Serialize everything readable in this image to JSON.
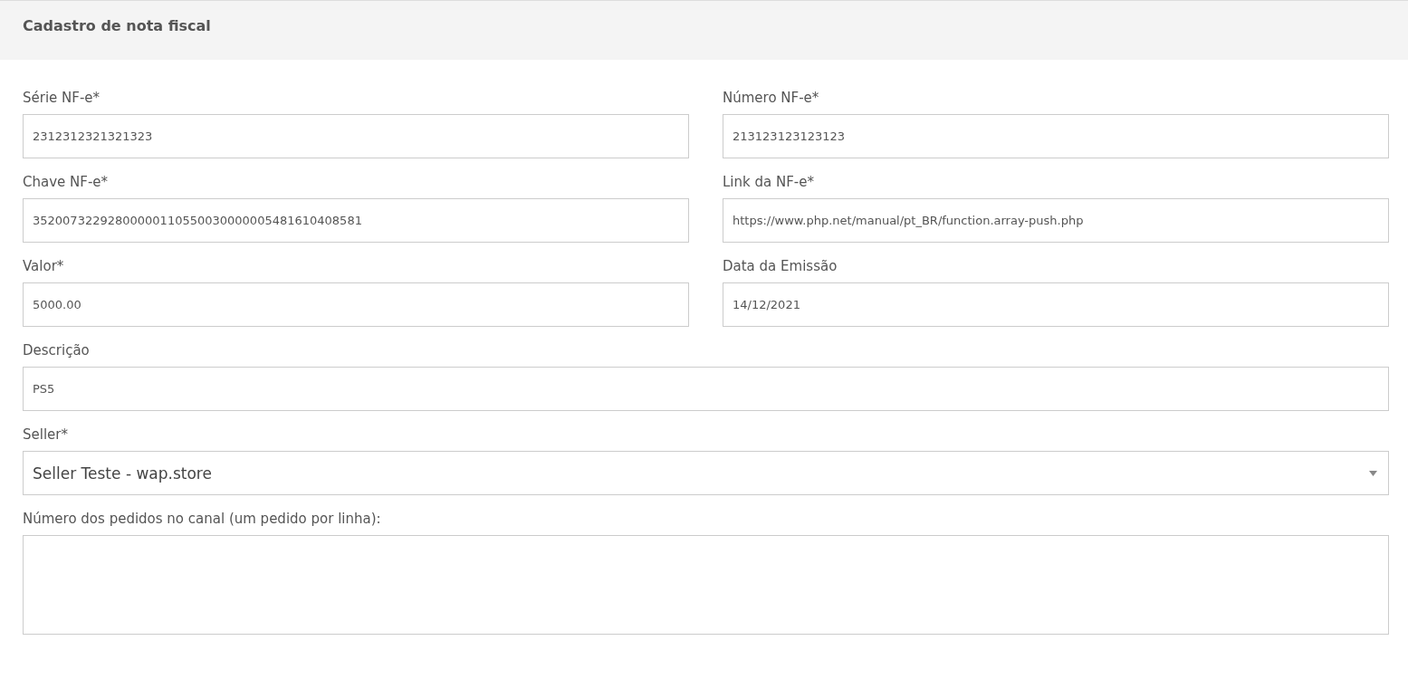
{
  "header": {
    "title": "Cadastro de nota fiscal"
  },
  "rows": [
    {
      "fields": [
        {
          "kind": "input",
          "label": "Série NF-e*",
          "value": "2312312321321323"
        },
        {
          "kind": "input",
          "label": "Número NF-e*",
          "value": "213123123123123"
        }
      ]
    },
    {
      "fields": [
        {
          "kind": "input",
          "label": "Chave NF-e*",
          "value": "35200732292800000110550030000005481610408581"
        },
        {
          "kind": "input",
          "label": "Link da NF-e*",
          "value": "https://www.php.net/manual/pt_BR/function.array-push.php"
        }
      ]
    },
    {
      "fields": [
        {
          "kind": "input",
          "label": "Valor*",
          "value": "5000.00"
        },
        {
          "kind": "input",
          "label": "Data da Emissão",
          "value": "14/12/2021"
        }
      ]
    },
    {
      "fields": [
        {
          "kind": "input",
          "label": "Descrição",
          "value": "PS5"
        }
      ]
    },
    {
      "fields": [
        {
          "kind": "select",
          "label": "Seller*",
          "value": "Seller Teste - wap.store"
        }
      ]
    },
    {
      "fields": [
        {
          "kind": "textarea",
          "label": "Número dos pedidos no canal (um pedido por linha):"
        }
      ]
    }
  ]
}
